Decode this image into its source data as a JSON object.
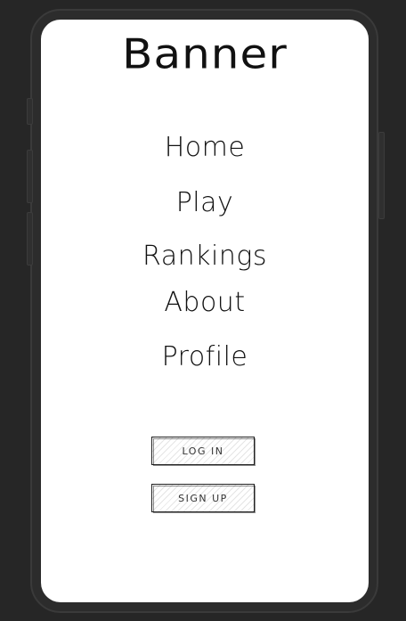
{
  "app": {
    "banner": "Banner"
  },
  "nav": {
    "items": [
      {
        "label": "Home"
      },
      {
        "label": "Play"
      },
      {
        "label": "Rankings"
      },
      {
        "label": "About"
      },
      {
        "label": "Profile"
      }
    ]
  },
  "auth": {
    "login_label": "LOG IN",
    "signup_label": "SIGN UP"
  },
  "colors": {
    "background": "#262626",
    "device_frame": "#2c2c2c",
    "screen": "#ffffff",
    "ink": "#111111"
  }
}
